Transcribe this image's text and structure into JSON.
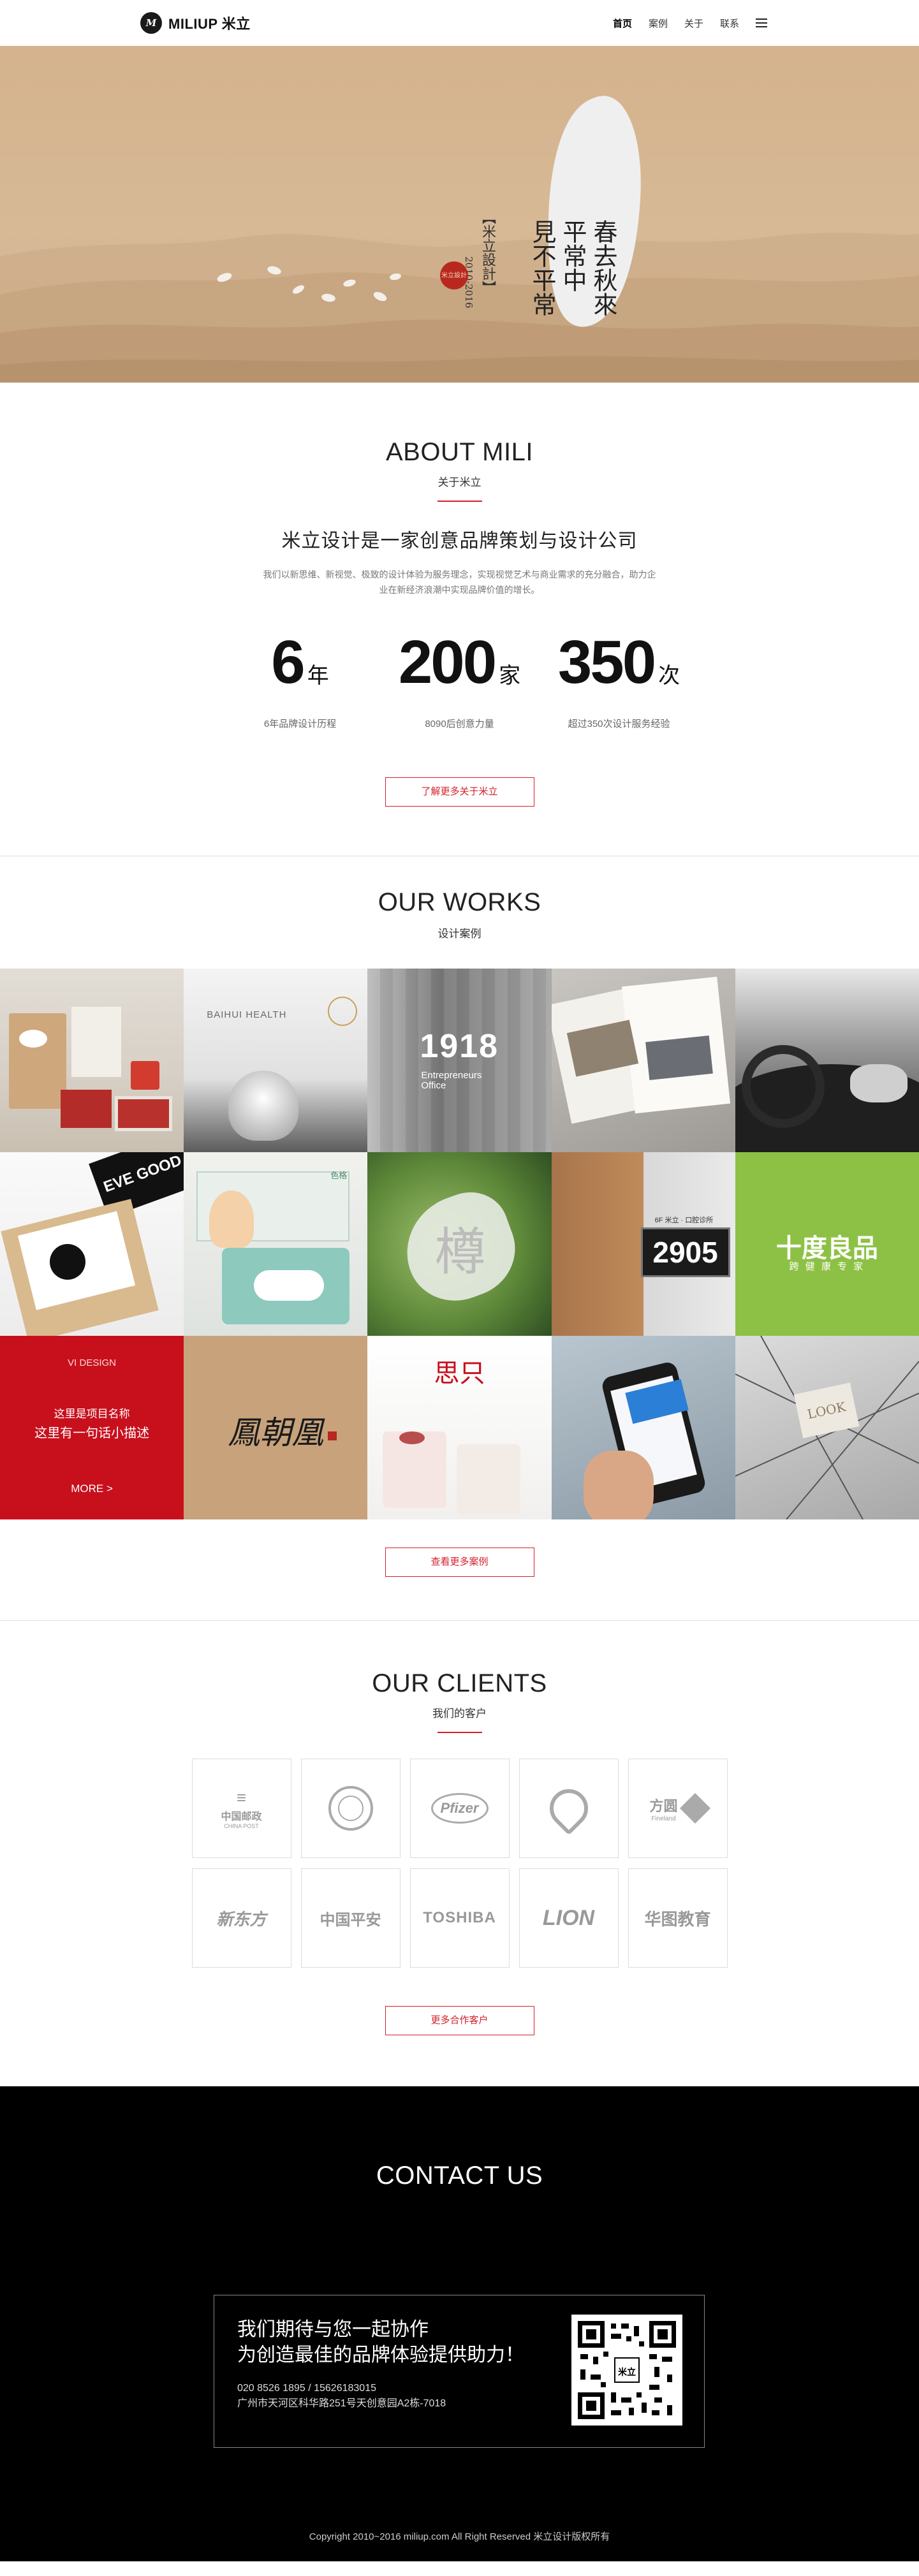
{
  "header": {
    "logo_mark": "M",
    "logo_text": "MILIUP 米立",
    "nav": [
      "首页",
      "案例",
      "关于",
      "联系"
    ]
  },
  "hero": {
    "poem": [
      "春去秋來",
      "平常中",
      "見不平常"
    ],
    "signature": "【米立設計】",
    "years": "2010-2016",
    "seal": "米立設計"
  },
  "about": {
    "title": "ABOUT MILI",
    "subtitle": "关于米立",
    "heading": "米立设计是一家创意品牌策划与设计公司",
    "desc": "我们以新思维、新视觉、极致的设计体验为服务理念，实现视觉艺术与商业需求的充分融合，助力企业在新经济浪潮中实现品牌价值的增长。",
    "stats": [
      {
        "num": "6",
        "unit": "年",
        "label": "6年品牌设计历程"
      },
      {
        "num": "200",
        "unit": "家",
        "label": "8090后创意力量"
      },
      {
        "num": "350",
        "unit": "次",
        "label": "超过350次设计服务经验"
      }
    ],
    "button": "了解更多关于米立"
  },
  "works": {
    "title": "OUR WORKS",
    "subtitle": "设计案例",
    "tiles": {
      "baihui": "BAIHUI HEALTH",
      "office_num": "1918",
      "office_sub": "Entrepreneurs Office",
      "box_text": "EVE GOOD",
      "tea_brand": "色格",
      "leaf_char": "樽",
      "plate_top": "6F 米立 · 口腔诊所",
      "plate_num": "2905",
      "green_brand": "十度良品",
      "green_sub": "跨 健 康 专 家",
      "red_tag": "VI DESIGN",
      "red_name": "这里是项目名称",
      "red_desc": "这里有一句话小描述",
      "red_more": "MORE >",
      "calligraphy": "鳳朝凰",
      "yogurt": "思只",
      "look": "LOOK"
    },
    "button": "查看更多案例"
  },
  "clients": {
    "title": "OUR CLIENTS",
    "subtitle": "我们的客户",
    "logos": [
      "中国邮政",
      "",
      "Pfizer",
      "",
      "方圆",
      "新东方",
      "中国平安",
      "TOSHIBA",
      "LION",
      "华图教育"
    ],
    "logo_subs": [
      "CHINA POST",
      "",
      "",
      "",
      "Fineland"
    ],
    "button": "更多合作客户"
  },
  "contact": {
    "title": "CONTACT US",
    "headline_1": "我们期待与您一起协作",
    "headline_2": "为创造最佳的品牌体验提供助力！",
    "phone": "020 8526 1895  /  15626183015",
    "address": "广州市天河区科华路251号天创意园A2栋-7018",
    "qr_center": "米立"
  },
  "footer": {
    "copyright": "Copyright 2010~2016 miliup.com All Right Reserved 米立设计版权所有"
  },
  "colors": {
    "accent": "#d2202b",
    "hero_bg": "#d4b38d",
    "green": "#8dc145",
    "footer": "#000000"
  }
}
